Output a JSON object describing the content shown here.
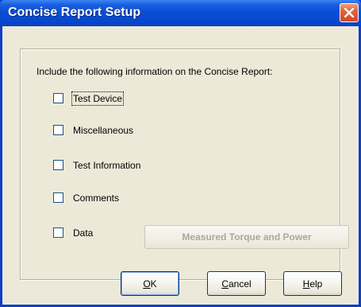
{
  "window": {
    "title": "Concise Report Setup"
  },
  "dialog": {
    "caption": "Include the following information on the Concise Report:",
    "options": [
      {
        "label": "Test Device",
        "checked": false
      },
      {
        "label": "Miscellaneous",
        "checked": false
      },
      {
        "label": "Test Information",
        "checked": false
      },
      {
        "label": "Comments",
        "checked": false
      },
      {
        "label": "Data",
        "checked": false
      }
    ],
    "measured_button_label": "Measured Torque and Power"
  },
  "buttons": {
    "ok": {
      "accel": "O",
      "rest": "K"
    },
    "cancel": {
      "accel": "C",
      "rest": "ancel"
    },
    "help": {
      "accel": "H",
      "rest": "elp"
    }
  }
}
